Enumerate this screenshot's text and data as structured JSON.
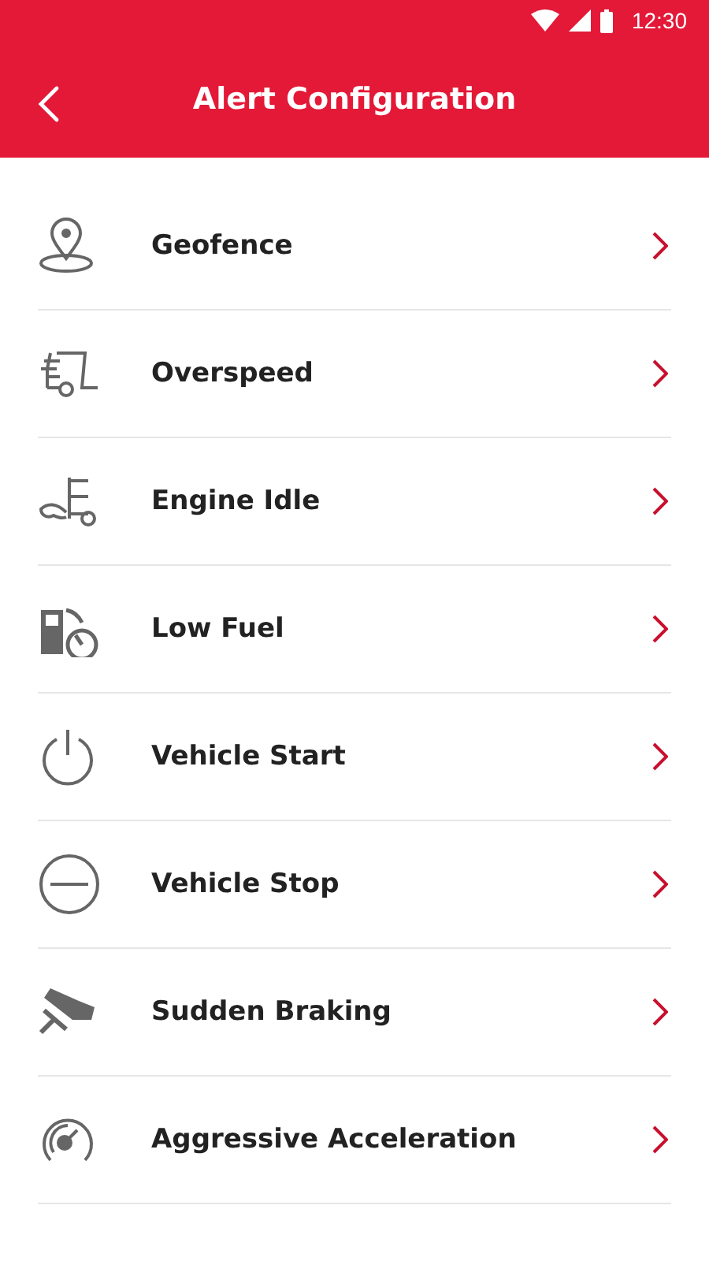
{
  "status_bar": {
    "time": "12:30"
  },
  "toolbar": {
    "title": "Alert Configuration"
  },
  "items": [
    {
      "label": "Geofence"
    },
    {
      "label": "Overspeed"
    },
    {
      "label": "Engine Idle"
    },
    {
      "label": "Low Fuel"
    },
    {
      "label": "Vehicle Start"
    },
    {
      "label": "Vehicle Stop"
    },
    {
      "label": "Sudden Braking"
    },
    {
      "label": "Aggressive Acceleration"
    }
  ]
}
